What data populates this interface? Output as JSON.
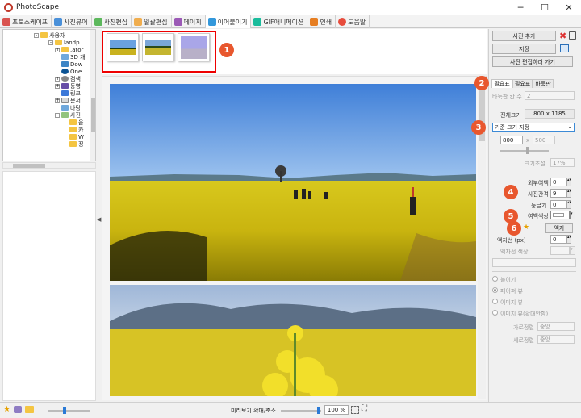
{
  "window": {
    "title": "PhotoScape",
    "minimize": "─",
    "maximize": "☐",
    "close": "✕"
  },
  "tabs": [
    {
      "label": "포토스케이프",
      "icon": "photoscape-icon",
      "color": "#d9534f"
    },
    {
      "label": "사진뷰어",
      "icon": "viewer-icon",
      "color": "#4a90d9"
    },
    {
      "label": "사진편집",
      "icon": "editor-icon",
      "color": "#5cb85c"
    },
    {
      "label": "일괄편집",
      "icon": "batch-icon",
      "color": "#f0ad4e"
    },
    {
      "label": "페이지",
      "icon": "page-icon",
      "color": "#9b59b6"
    },
    {
      "label": "이어붙이기",
      "icon": "combine-icon",
      "color": "#3498db"
    },
    {
      "label": "GIF애니메이션",
      "icon": "gif-icon",
      "color": "#1abc9c"
    },
    {
      "label": "인쇄",
      "icon": "print-icon",
      "color": "#e67e22"
    },
    {
      "label": "도움말",
      "icon": "help-icon",
      "color": "#e74c3c"
    }
  ],
  "tree": {
    "items": [
      {
        "label": "사용자",
        "indent": 0,
        "box": "-"
      },
      {
        "label": "landp",
        "indent": 1,
        "box": "-"
      },
      {
        "label": ".ator",
        "indent": 2,
        "box": "+"
      },
      {
        "label": "3D 개",
        "indent": 2,
        "box": ""
      },
      {
        "label": "Dow",
        "indent": 2,
        "box": ""
      },
      {
        "label": "One",
        "indent": 2,
        "box": ""
      },
      {
        "label": "검색",
        "indent": 2,
        "box": "+"
      },
      {
        "label": "동영",
        "indent": 2,
        "box": "+"
      },
      {
        "label": "링크",
        "indent": 2,
        "box": ""
      },
      {
        "label": "문서",
        "indent": 2,
        "box": "+"
      },
      {
        "label": "바탕",
        "indent": 2,
        "box": ""
      },
      {
        "label": "사진",
        "indent": 2,
        "box": "-"
      },
      {
        "label": "을",
        "indent": 3,
        "box": ""
      },
      {
        "label": "카",
        "indent": 3,
        "box": ""
      },
      {
        "label": "W",
        "indent": 3,
        "box": ""
      },
      {
        "label": "정",
        "indent": 3,
        "box": ""
      }
    ]
  },
  "thumbnails": [
    {
      "name": "thumb-1",
      "colors": [
        "#6aa2e0",
        "#c9b21f"
      ]
    },
    {
      "name": "thumb-2",
      "colors": [
        "#7aa6d8",
        "#c4b530"
      ]
    },
    {
      "name": "thumb-3",
      "colors": [
        "#a9a6e8",
        "#b8b0c8"
      ]
    }
  ],
  "callouts": [
    "1",
    "2",
    "3",
    "4",
    "5",
    "6"
  ],
  "right": {
    "add_photo": "사진 추가",
    "save": "저장",
    "go_edit": "사진 편집하러 가기",
    "tabs": [
      "필요표",
      "필요표",
      "바둑판"
    ],
    "grid_label": "바둑판 칸 수",
    "grid_value": "2",
    "total_size_label": "전체크기",
    "total_size_value": "800 x 1185",
    "size_mode": "기준 크기 지정",
    "width_value": "800",
    "height_value": "500",
    "x_sep": "x",
    "size_ratio_label": "크기조절",
    "size_ratio_value": "17%",
    "outer_margin_label": "외부여백",
    "outer_margin_value": "0",
    "photo_spacing_label": "사진간격",
    "photo_spacing_value": "9",
    "round_label": "둥글기",
    "round_value": "0",
    "margin_color_label": "여백색상",
    "frame_button": "액자",
    "frame_line_label": "액자선 (px)",
    "frame_line_value": "0",
    "frame_color_label": "액자선 색상",
    "radio_options": [
      "늘이기",
      "페이퍼 뷰",
      "이미지 뷰",
      "이미지 뷰(확대안함)"
    ],
    "halign_label": "가로정렬",
    "halign_value": "중앙",
    "valign_label": "세로정렬",
    "valign_value": "중앙"
  },
  "status": {
    "zoom_label": "미리보기 확대/축소",
    "zoom_value": "100 %"
  }
}
